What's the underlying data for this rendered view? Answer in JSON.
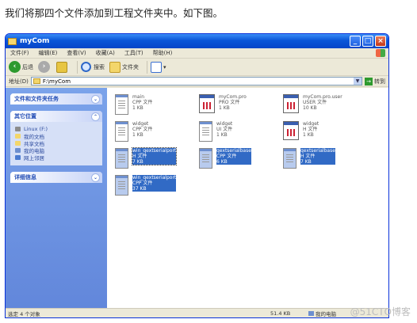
{
  "caption": "我们将那四个文件添加到工程文件夹中。如下图。",
  "window": {
    "title": "myCom",
    "menu": [
      "文件(F)",
      "编辑(E)",
      "查看(V)",
      "收藏(A)",
      "工具(T)",
      "帮助(H)"
    ],
    "toolbar": {
      "back": "后退",
      "search": "搜索",
      "folders": "文件夹"
    },
    "address": {
      "label": "地址(D)",
      "value": "F:\\myCom",
      "go": "转到"
    }
  },
  "leftpane": {
    "tasks_title": "文件和文件夹任务",
    "places_title": "其它位置",
    "places": [
      "Linux (F:)",
      "我的文档",
      "共享文档",
      "我的电脑",
      "网上邻居"
    ],
    "details_title": "详细信息"
  },
  "files": [
    {
      "name": "main",
      "type": "CPP 文件",
      "size": "1 KB"
    },
    {
      "name": "myCom.pro",
      "type": "PRO 文件",
      "size": "1 KB"
    },
    {
      "name": "myCom.pro.user",
      "type": "USER 文件",
      "size": "10 KB"
    },
    {
      "name": "widget",
      "type": "CPP 文件",
      "size": "1 KB"
    },
    {
      "name": "widget",
      "type": "UI 文件",
      "size": "1 KB"
    },
    {
      "name": "widget",
      "type": "H 文件",
      "size": "1 KB"
    },
    {
      "name": "win_qextserialport",
      "type": "H 文件",
      "size": "7 KB"
    },
    {
      "name": "qextserialbase",
      "type": "CPP 文件",
      "size": "6 KB"
    },
    {
      "name": "qextserialbase",
      "type": "H 文件",
      "size": "7 KB"
    },
    {
      "name": "win_qextserialport",
      "type": "CPP 文件",
      "size": "37 KB"
    }
  ],
  "status": {
    "count": "选定 4 个对象",
    "size": "51.4 KB",
    "location": "我的电脑"
  },
  "watermark": "@51CTO博客"
}
